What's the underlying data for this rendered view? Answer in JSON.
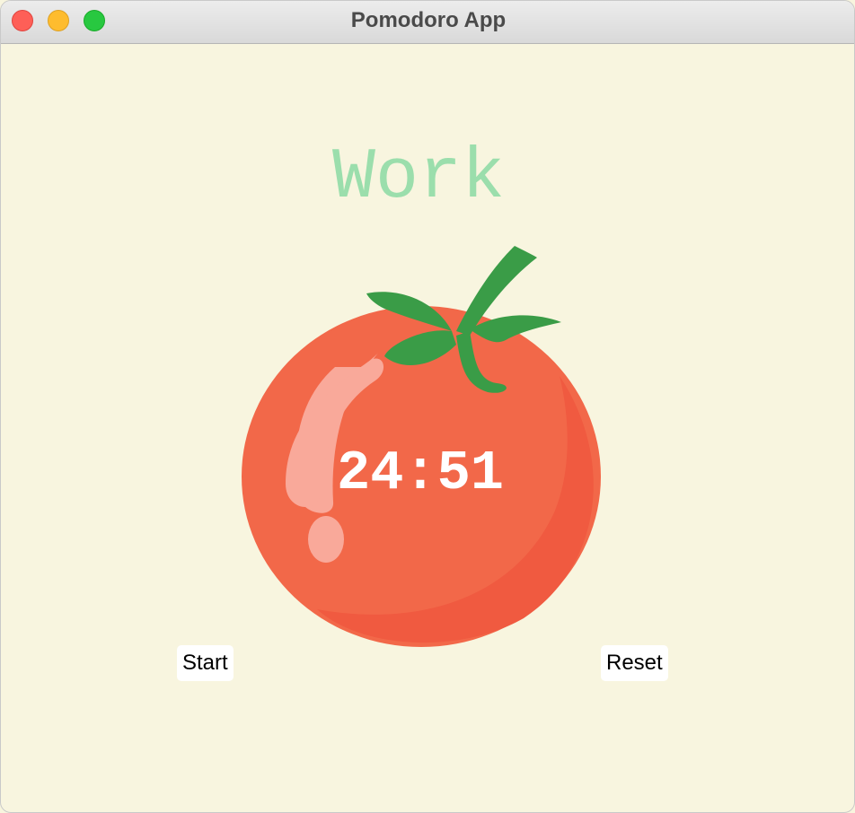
{
  "window": {
    "title": "Pomodoro App"
  },
  "timer": {
    "mode_label": "Work",
    "time": "24:51"
  },
  "controls": {
    "start_label": "Start",
    "reset_label": "Reset"
  },
  "colors": {
    "background": "#f8f5df",
    "mode_label": "#9bdeac",
    "tomato_body": "#f26849",
    "tomato_leaf": "#3a9c47",
    "timer_text": "#ffffff"
  },
  "icons": {
    "tomato": "tomato-icon"
  }
}
